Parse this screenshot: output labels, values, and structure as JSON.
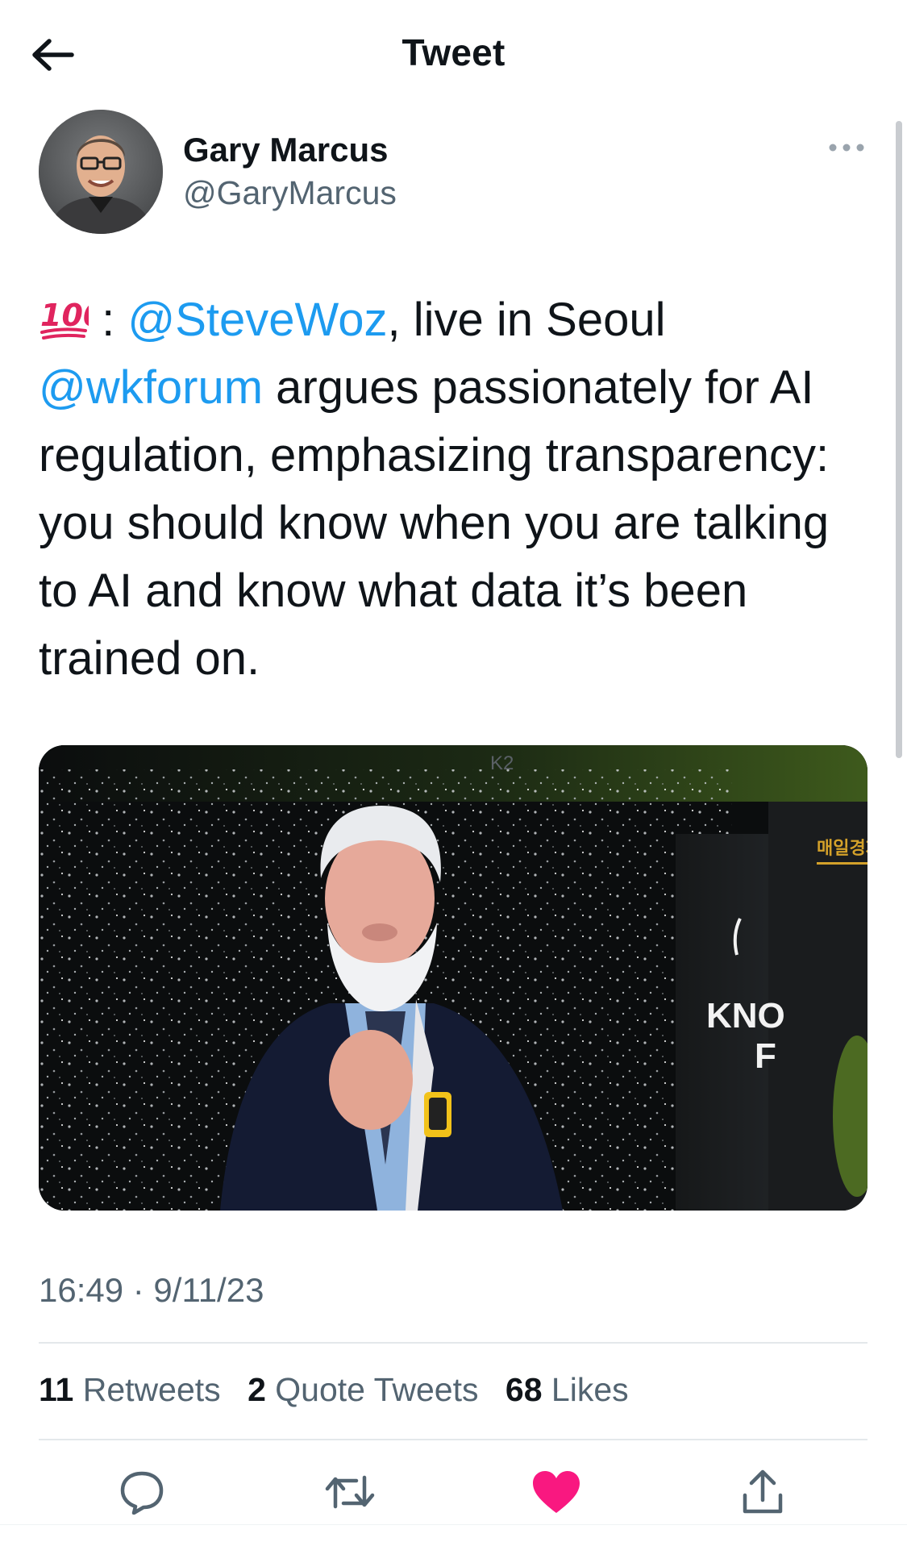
{
  "header": {
    "title": "Tweet",
    "back_icon": "arrow-left-icon"
  },
  "author": {
    "name": "Gary Marcus",
    "handle": "@GaryMarcus",
    "avatar_icon": "avatar-photo"
  },
  "more_icon": "more-options-icon",
  "tweet": {
    "emoji": "💯",
    "emoji_icon": "hundred-points-icon",
    "colon": " : ",
    "mention1": "@SteveWoz",
    "text1": ", live in Seoul ",
    "mention2": "@wkforum",
    "text2": " argues passionately for AI regulation, emphasizing transparency: you should know when you are talking to AI and know what data it’s been trained on."
  },
  "media": {
    "type": "photo",
    "screen_label": "K2",
    "sign_text_korean": "매일경제",
    "sign_text_1": "KNO",
    "sign_text_2": "F"
  },
  "meta": {
    "timestamp": "16:49 · 9/11/23"
  },
  "stats": {
    "retweets_count": "11",
    "retweets_label": " Retweets",
    "quotes_count": "2",
    "quotes_label": " Quote Tweets",
    "likes_count": "68",
    "likes_label": " Likes"
  },
  "actions": [
    "reply-icon",
    "retweet-icon",
    "like-icon",
    "share-icon"
  ],
  "colors": {
    "accent": "#1d9bf0",
    "like": "#f91880",
    "secondary_text": "#536471"
  }
}
